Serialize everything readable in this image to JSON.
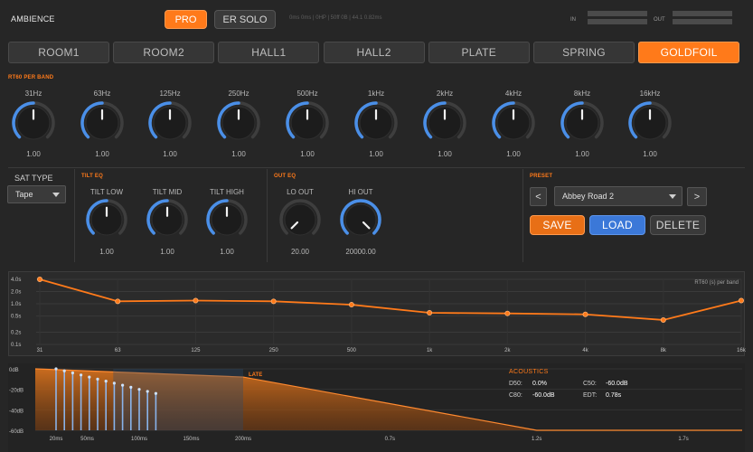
{
  "app": {
    "title": "AMBIENCE",
    "mode_pro": "PRO",
    "mode_er_solo": "ER SOLO",
    "info": "0ms 0ms | 0HP | 50ff 0B | 44.1 0.82ms",
    "meter_in": "IN",
    "meter_out": "OUT"
  },
  "tabs": [
    "ROOM1",
    "ROOM2",
    "HALL1",
    "HALL2",
    "PLATE",
    "SPRING",
    "GOLDFOIL"
  ],
  "active_tab": "GOLDFOIL",
  "rt60": {
    "title": "RT60 PER BAND",
    "bands": [
      {
        "label": "31Hz",
        "value": "1.00",
        "level": 0.5
      },
      {
        "label": "63Hz",
        "value": "1.00",
        "level": 0.5
      },
      {
        "label": "125Hz",
        "value": "1.00",
        "level": 0.5
      },
      {
        "label": "250Hz",
        "value": "1.00",
        "level": 0.5
      },
      {
        "label": "500Hz",
        "value": "1.00",
        "level": 0.5
      },
      {
        "label": "1kHz",
        "value": "1.00",
        "level": 0.5
      },
      {
        "label": "2kHz",
        "value": "1.00",
        "level": 0.5
      },
      {
        "label": "4kHz",
        "value": "1.00",
        "level": 0.5
      },
      {
        "label": "8kHz",
        "value": "1.00",
        "level": 0.5
      },
      {
        "label": "16kHz",
        "value": "1.00",
        "level": 0.5
      }
    ]
  },
  "sat": {
    "label": "SAT TYPE",
    "value": "Tape"
  },
  "tilt_eq": {
    "title": "TILT EQ",
    "knobs": [
      {
        "label": "TILT LOW",
        "value": "1.00",
        "level": 0.5
      },
      {
        "label": "TILT MID",
        "value": "1.00",
        "level": 0.5
      },
      {
        "label": "TILT HIGH",
        "value": "1.00",
        "level": 0.5
      }
    ]
  },
  "out_eq": {
    "title": "OUT EQ",
    "knobs": [
      {
        "label": "LO OUT",
        "value": "20.00",
        "level": 0.0
      },
      {
        "label": "HI OUT",
        "value": "20000.00",
        "level": 1.0
      }
    ]
  },
  "preset": {
    "title": "PRESET",
    "prev_label": "<",
    "next_label": ">",
    "selected": "Abbey Road 2",
    "save_label": "SAVE",
    "load_label": "LOAD",
    "delete_label": "DELETE"
  },
  "colors": {
    "accent": "#ff7a1a",
    "knob_arc": "#4a8fe8",
    "load": "#3b78d8"
  },
  "chart_data": [
    {
      "type": "line",
      "title": "RT60 (s) per band",
      "x": [
        "31",
        "63",
        "125",
        "250",
        "500",
        "1k",
        "2k",
        "4k",
        "8k",
        "16k"
      ],
      "y_ticks": [
        "4.0s",
        "2.0s",
        "1.0s",
        "0.5s",
        "0.2s",
        "0.1s"
      ],
      "values": [
        4.0,
        1.15,
        1.2,
        1.15,
        0.95,
        0.6,
        0.58,
        0.55,
        0.4,
        1.2
      ],
      "grid": true
    },
    {
      "type": "area",
      "y_ticks": [
        "0dB",
        "-20dB",
        "-40dB",
        "-60dB"
      ],
      "x_ticks": [
        "20ms",
        "50ms",
        "100ms",
        "150ms",
        "200ms",
        "0.7s",
        "1.2s",
        "1.7s"
      ],
      "late_label": "LATE",
      "early_reflections_db": [
        0,
        -1,
        -2,
        -3,
        -4,
        -5,
        -6,
        -7,
        -8,
        -9,
        -10,
        -11,
        -12
      ],
      "envelope_db": [
        [
          0,
          0
        ],
        [
          200,
          -8
        ],
        [
          1200,
          -60
        ],
        [
          1900,
          -60
        ]
      ]
    }
  ],
  "acoustics": {
    "title": "ACOUSTICS",
    "items": [
      {
        "label": "D50:",
        "value": "0.0%"
      },
      {
        "label": "C50:",
        "value": "-60.0dB"
      },
      {
        "label": "C80:",
        "value": "-60.0dB"
      },
      {
        "label": "EDT:",
        "value": "0.78s"
      }
    ]
  }
}
